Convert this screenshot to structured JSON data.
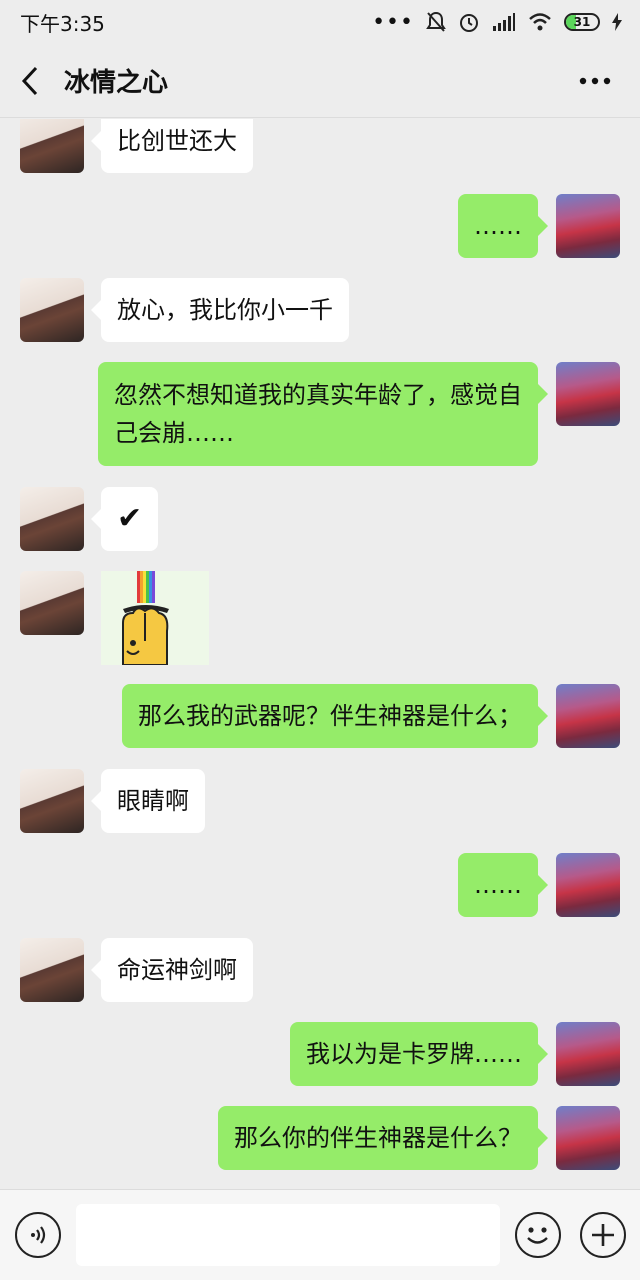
{
  "status": {
    "time": "下午3:35",
    "battery": "31"
  },
  "header": {
    "title": "冰情之心"
  },
  "messages": [
    {
      "side": "left",
      "type": "text",
      "text": "比创世还大"
    },
    {
      "side": "right",
      "type": "text",
      "text": "……"
    },
    {
      "side": "left",
      "type": "text",
      "text": "放心，我比你小一千"
    },
    {
      "side": "right",
      "type": "text",
      "text": "忽然不想知道我的真实年龄了，感觉自己会崩……"
    },
    {
      "side": "left",
      "type": "text",
      "text": "✔"
    },
    {
      "side": "left",
      "type": "sticker",
      "text": ""
    },
    {
      "side": "right",
      "type": "text",
      "text": "那么我的武器呢？伴生神器是什么；"
    },
    {
      "side": "left",
      "type": "text",
      "text": "眼睛啊"
    },
    {
      "side": "right",
      "type": "text",
      "text": "……"
    },
    {
      "side": "left",
      "type": "text",
      "text": "命运神剑啊"
    },
    {
      "side": "right",
      "type": "text",
      "text": "我以为是卡罗牌……"
    },
    {
      "side": "right",
      "type": "text",
      "text": "那么你的伴生神器是什么？"
    }
  ],
  "input": {
    "value": "",
    "placeholder": ""
  },
  "colors": {
    "background": "#ededed",
    "bubble_self": "#95ec69",
    "bubble_other": "#ffffff"
  },
  "icons": [
    "back-arrow-icon",
    "more-icon",
    "voice-icon",
    "emoji-icon",
    "plus-icon",
    "wifi-icon",
    "signal-icon",
    "mute-icon",
    "alarm-icon",
    "charging-icon"
  ]
}
